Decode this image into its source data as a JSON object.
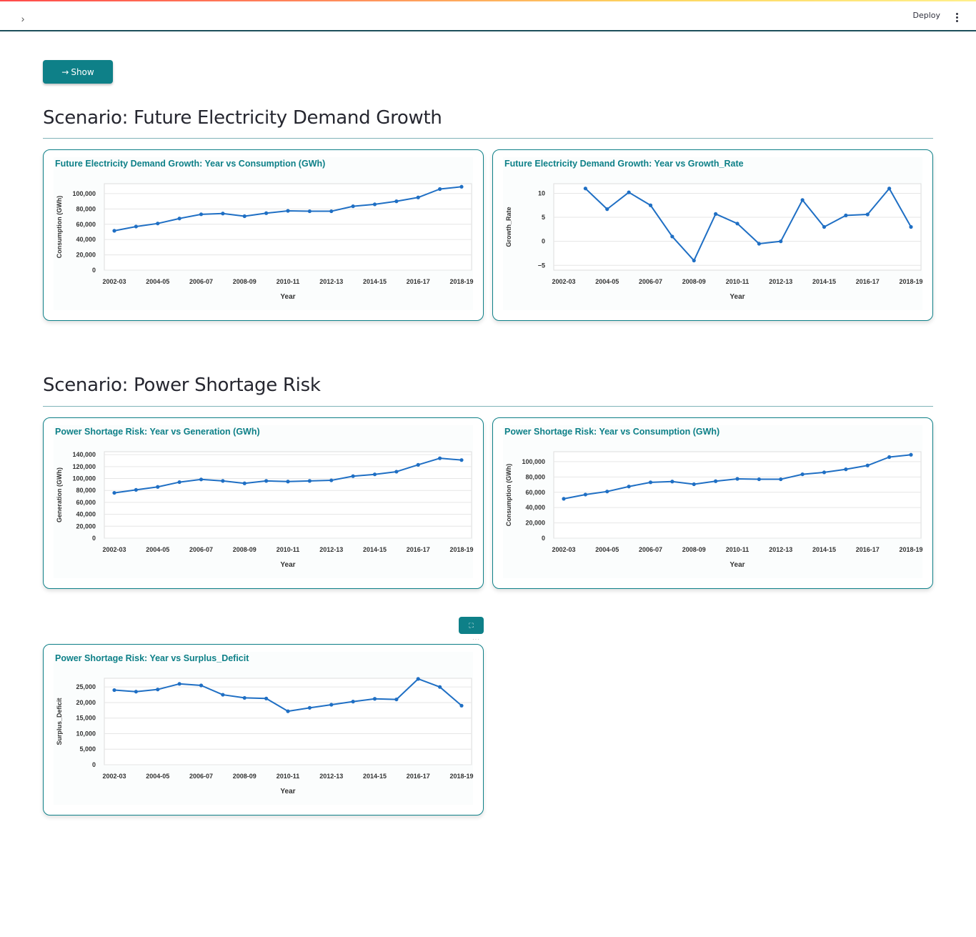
{
  "header": {
    "deploy_label": "Deploy",
    "sidebar_toggle": "›"
  },
  "show_button": {
    "label": "Show",
    "icon": "arrow-right-icon"
  },
  "sections": [
    {
      "title": "Scenario: Future Electricity Demand Growth"
    },
    {
      "title": "Scenario: Power Shortage Risk"
    }
  ],
  "colors": {
    "accent": "#0e8088",
    "line": "#1f6fc4",
    "border": "#0e8088"
  },
  "chart_data": [
    {
      "type": "line",
      "title": "Future Electricity Demand Growth: Year vs Consumption (GWh)",
      "xlabel": "Year",
      "ylabel": "Consumption (GWh)",
      "x": [
        "2002-03",
        "2003-04",
        "2004-05",
        "2005-06",
        "2006-07",
        "2007-08",
        "2008-09",
        "2009-10",
        "2010-11",
        "2011-12",
        "2012-13",
        "2013-14",
        "2014-15",
        "2015-16",
        "2016-17",
        "2017-18",
        "2018-19"
      ],
      "values": [
        51500,
        57000,
        61000,
        67500,
        73000,
        74000,
        70500,
        74500,
        77500,
        77000,
        77000,
        83500,
        86000,
        90000,
        95000,
        106000,
        109000
      ],
      "yticks": [
        0,
        20000,
        40000,
        60000,
        80000,
        100000
      ],
      "ytick_labels": [
        "0",
        "20,000",
        "40,000",
        "60,000",
        "80,000",
        "100,000"
      ],
      "xtick_labels": [
        "2002-03",
        "2004-05",
        "2006-07",
        "2008-09",
        "2010-11",
        "2012-13",
        "2014-15",
        "2016-17",
        "2018-19"
      ],
      "ylim": [
        0,
        113000
      ]
    },
    {
      "type": "line",
      "title": "Future Electricity Demand Growth: Year vs Growth_Rate",
      "xlabel": "Year",
      "ylabel": "Growth_Rate",
      "x": [
        "2003-04",
        "2004-05",
        "2005-06",
        "2006-07",
        "2007-08",
        "2008-09",
        "2009-10",
        "2010-11",
        "2011-12",
        "2012-13",
        "2013-14",
        "2014-15",
        "2015-16",
        "2016-17",
        "2017-18",
        "2018-19"
      ],
      "values": [
        11,
        6.7,
        10.2,
        7.5,
        1,
        -4,
        5.7,
        3.7,
        -0.5,
        0,
        8.6,
        3,
        5.4,
        5.6,
        11,
        3
      ],
      "yticks": [
        -5,
        0,
        5,
        10
      ],
      "ytick_labels": [
        "−5",
        "0",
        "5",
        "10"
      ],
      "xtick_labels": [
        "2002-03",
        "2004-05",
        "2006-07",
        "2008-09",
        "2010-11",
        "2012-13",
        "2014-15",
        "2016-17",
        "2018-19"
      ],
      "ylim": [
        -6,
        12
      ]
    },
    {
      "type": "line",
      "title": "Power Shortage Risk: Year vs Generation (GWh)",
      "xlabel": "Year",
      "ylabel": "Generation (GWh)",
      "x": [
        "2002-03",
        "2003-04",
        "2004-05",
        "2005-06",
        "2006-07",
        "2007-08",
        "2008-09",
        "2009-10",
        "2010-11",
        "2011-12",
        "2012-13",
        "2013-14",
        "2014-15",
        "2015-16",
        "2016-17",
        "2017-18",
        "2018-19"
      ],
      "values": [
        76000,
        81000,
        86000,
        94000,
        98500,
        96000,
        92000,
        96000,
        95000,
        96000,
        97000,
        104000,
        107000,
        111500,
        123000,
        134000,
        131000
      ],
      "yticks": [
        0,
        20000,
        40000,
        60000,
        80000,
        100000,
        120000,
        140000
      ],
      "ytick_labels": [
        "0",
        "20,000",
        "40,000",
        "60,000",
        "80,000",
        "100,000",
        "120,000",
        "140,000"
      ],
      "xtick_labels": [
        "2002-03",
        "2004-05",
        "2006-07",
        "2008-09",
        "2010-11",
        "2012-13",
        "2014-15",
        "2016-17",
        "2018-19"
      ],
      "ylim": [
        0,
        145000
      ]
    },
    {
      "type": "line",
      "title": "Power Shortage Risk: Year vs Consumption (GWh)",
      "xlabel": "Year",
      "ylabel": "Consumption (GWh)",
      "x": [
        "2002-03",
        "2003-04",
        "2004-05",
        "2005-06",
        "2006-07",
        "2007-08",
        "2008-09",
        "2009-10",
        "2010-11",
        "2011-12",
        "2012-13",
        "2013-14",
        "2014-15",
        "2015-16",
        "2016-17",
        "2017-18",
        "2018-19"
      ],
      "values": [
        51500,
        57000,
        61000,
        67500,
        73000,
        74000,
        70500,
        74500,
        77500,
        77000,
        77000,
        83500,
        86000,
        90000,
        95000,
        106000,
        109000
      ],
      "yticks": [
        0,
        20000,
        40000,
        60000,
        80000,
        100000
      ],
      "ytick_labels": [
        "0",
        "20,000",
        "40,000",
        "60,000",
        "80,000",
        "100,000"
      ],
      "xtick_labels": [
        "2002-03",
        "2004-05",
        "2006-07",
        "2008-09",
        "2010-11",
        "2012-13",
        "2014-15",
        "2016-17",
        "2018-19"
      ],
      "ylim": [
        0,
        113000
      ]
    },
    {
      "type": "line",
      "title": "Power Shortage Risk: Year vs Surplus_Deficit",
      "xlabel": "Year",
      "ylabel": "Surplus_Deficit",
      "x": [
        "2002-03",
        "2003-04",
        "2004-05",
        "2005-06",
        "2006-07",
        "2007-08",
        "2008-09",
        "2009-10",
        "2010-11",
        "2011-12",
        "2012-13",
        "2013-14",
        "2014-15",
        "2015-16",
        "2016-17",
        "2017-18",
        "2018-19"
      ],
      "values": [
        24000,
        23500,
        24200,
        26000,
        25500,
        22500,
        21500,
        21300,
        17200,
        18300,
        19300,
        20300,
        21200,
        21000,
        27600,
        25000,
        19000
      ],
      "yticks": [
        0,
        5000,
        10000,
        15000,
        20000,
        25000
      ],
      "ytick_labels": [
        "0",
        "5,000",
        "10,000",
        "15,000",
        "20,000",
        "25,000"
      ],
      "xtick_labels": [
        "2002-03",
        "2004-05",
        "2006-07",
        "2008-09",
        "2010-11",
        "2012-13",
        "2014-15",
        "2016-17",
        "2018-19"
      ],
      "ylim": [
        0,
        27800
      ]
    }
  ]
}
